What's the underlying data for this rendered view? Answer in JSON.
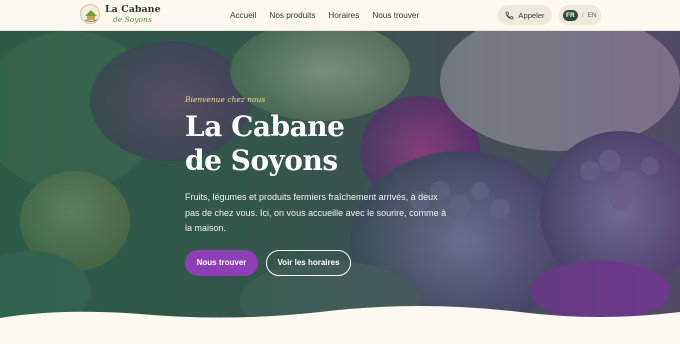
{
  "brand": {
    "name_line1": "La Cabane",
    "name_line2": "de Soyons"
  },
  "nav": {
    "items": [
      {
        "label": "Accueil"
      },
      {
        "label": "Nos produits"
      },
      {
        "label": "Horaires"
      },
      {
        "label": "Nous trouver"
      }
    ]
  },
  "header_actions": {
    "call_label": "Appeler",
    "call_icon": "phone-icon",
    "lang_active": "FR",
    "lang_separator": "/",
    "lang_other": "EN"
  },
  "hero": {
    "eyebrow": "Bienvenue chez nous",
    "title_line1": "La Cabane",
    "title_line2": "de Soyons",
    "description": "Fruits, légumes et produits fermiers fraîchement arrivés, à deux pas de chez vous. Ici, on vous accueille avec le sourire, comme à la maison.",
    "primary_button": "Nous trouver",
    "secondary_button": "Voir les horaires"
  },
  "colors": {
    "background": "#fdf9f1",
    "primary_button": "#8e3fb5",
    "eyebrow": "#e8e07a",
    "brand_dark": "#2b3b2c",
    "brand_green": "#5d8a2a"
  }
}
